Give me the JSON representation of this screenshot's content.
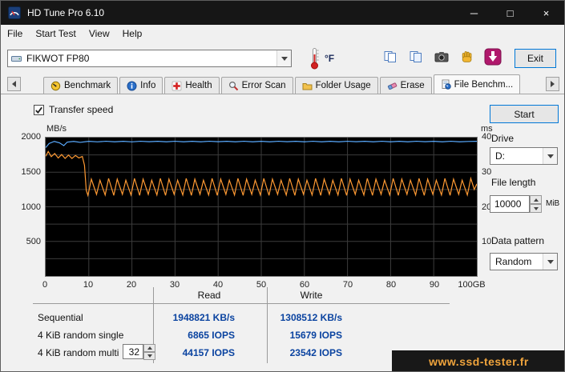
{
  "window": {
    "title": "HD Tune Pro 6.10",
    "controls": {
      "minimize": "─",
      "maximize": "□",
      "close": "×"
    }
  },
  "menu": {
    "items": [
      "File",
      "Start Test",
      "View",
      "Help"
    ]
  },
  "toolbar": {
    "drive_selector": "FIKWOT FP80",
    "temperature_unit": "°F",
    "exit_button": "Exit"
  },
  "tabs": {
    "items": [
      {
        "label": "Benchmark",
        "icon": "speedometer-icon"
      },
      {
        "label": "Info",
        "icon": "info-icon"
      },
      {
        "label": "Health",
        "icon": "health-icon"
      },
      {
        "label": "Error Scan",
        "icon": "error-scan-icon"
      },
      {
        "label": "Folder Usage",
        "icon": "folder-icon"
      },
      {
        "label": "Erase",
        "icon": "eraser-icon"
      },
      {
        "label": "File Benchm...",
        "icon": "file-benchmark-icon",
        "active": true
      }
    ]
  },
  "file_benchmark": {
    "transfer_speed_label": "Transfer speed",
    "transfer_speed_checked": true,
    "start_button": "Start",
    "drive_label": "Drive",
    "drive_value": "D:",
    "file_length_label": "File length",
    "file_length_value": "10000",
    "file_length_unit": "MiB",
    "data_pattern_label": "Data pattern",
    "data_pattern_value": "Random"
  },
  "results": {
    "read_header": "Read",
    "write_header": "Write",
    "rows": [
      {
        "label": "Sequential",
        "read": "1948821 KB/s",
        "write": "1308512 KB/s"
      },
      {
        "label": "4 KiB random single",
        "read": "6865 IOPS",
        "write": "15679 IOPS"
      },
      {
        "label": "4 KiB random multi",
        "threads": "32",
        "read": "44157 IOPS",
        "write": "23542 IOPS"
      }
    ]
  },
  "watermark": {
    "text": "www.ssd-tester.fr"
  },
  "colors": {
    "read_line": "#5aabff",
    "write_line": "#ff9a33",
    "chart_bg": "#000000",
    "chart_grid": "#3c3c3c",
    "value_text": "#0a43a0",
    "watermark_text": "#f0a43c",
    "watermark_bg": "#181818",
    "accent": "#0078d7"
  },
  "chart_data": {
    "type": "line",
    "title": "File Benchmark transfer speed",
    "y_left": {
      "label": "MB/s",
      "min": 0,
      "max": 2000,
      "ticks": [
        500,
        1000,
        1500,
        2000
      ],
      "minor_step": 250
    },
    "y_right": {
      "label": "ms",
      "min": 0,
      "max": 40,
      "ticks": [
        10,
        20,
        30,
        40
      ]
    },
    "x": {
      "min": 0,
      "max": 100,
      "tick_values": [
        0,
        10,
        20,
        30,
        40,
        50,
        60,
        70,
        80,
        90,
        100
      ],
      "tick_labels": [
        "0",
        "10",
        "20",
        "30",
        "40",
        "50",
        "60",
        "70",
        "80",
        "90",
        "100GB"
      ]
    },
    "grid": true,
    "series": [
      {
        "name": "read",
        "color": "#5aabff",
        "points": [
          [
            0,
            1855
          ],
          [
            0.8,
            1915
          ],
          [
            2,
            1945
          ],
          [
            3.2,
            1925
          ],
          [
            4.2,
            1885
          ],
          [
            5,
            1935
          ],
          [
            6.5,
            1945
          ],
          [
            8,
            1932
          ],
          [
            10,
            1946
          ],
          [
            12,
            1938
          ],
          [
            14,
            1947
          ],
          [
            16,
            1940
          ],
          [
            18,
            1946
          ],
          [
            20,
            1938
          ],
          [
            22,
            1947
          ],
          [
            24,
            1941
          ],
          [
            26,
            1946
          ],
          [
            28,
            1939
          ],
          [
            30,
            1947
          ],
          [
            32,
            1940
          ],
          [
            34,
            1946
          ],
          [
            36,
            1939
          ],
          [
            38,
            1947
          ],
          [
            40,
            1941
          ],
          [
            42,
            1946
          ],
          [
            44,
            1939
          ],
          [
            46,
            1947
          ],
          [
            48,
            1940
          ],
          [
            50,
            1946
          ],
          [
            52,
            1939
          ],
          [
            54,
            1947
          ],
          [
            56,
            1941
          ],
          [
            58,
            1946
          ],
          [
            60,
            1939
          ],
          [
            62,
            1947
          ],
          [
            64,
            1940
          ],
          [
            66,
            1946
          ],
          [
            68,
            1939
          ],
          [
            70,
            1947
          ],
          [
            72,
            1941
          ],
          [
            74,
            1946
          ],
          [
            76,
            1939
          ],
          [
            78,
            1947
          ],
          [
            80,
            1940
          ],
          [
            82,
            1946
          ],
          [
            84,
            1939
          ],
          [
            86,
            1947
          ],
          [
            88,
            1941
          ],
          [
            90,
            1946
          ],
          [
            92,
            1939
          ],
          [
            94,
            1947
          ],
          [
            96,
            1940
          ],
          [
            98,
            1944
          ],
          [
            100,
            1946
          ]
        ]
      },
      {
        "name": "write",
        "color": "#ff9a33",
        "points": [
          [
            0,
            1730
          ],
          [
            0.6,
            1800
          ],
          [
            1.3,
            1725
          ],
          [
            2.1,
            1770
          ],
          [
            2.9,
            1705
          ],
          [
            3.7,
            1755
          ],
          [
            4.5,
            1700
          ],
          [
            5.3,
            1748
          ],
          [
            6.1,
            1698
          ],
          [
            6.9,
            1742
          ],
          [
            7.7,
            1706
          ],
          [
            8.5,
            1728
          ],
          [
            9,
            1600
          ],
          [
            9.4,
            1240
          ],
          [
            9.8,
            1165
          ],
          [
            10.6,
            1400
          ],
          [
            11.8,
            1180
          ],
          [
            12.6,
            1385
          ],
          [
            13.8,
            1170
          ],
          [
            14.6,
            1410
          ],
          [
            15.8,
            1165
          ],
          [
            16.6,
            1400
          ],
          [
            17.8,
            1180
          ],
          [
            18.6,
            1385
          ],
          [
            19.8,
            1170
          ],
          [
            20.6,
            1410
          ],
          [
            21.8,
            1165
          ],
          [
            22.6,
            1400
          ],
          [
            23.8,
            1180
          ],
          [
            24.6,
            1385
          ],
          [
            25.8,
            1170
          ],
          [
            26.6,
            1410
          ],
          [
            27.8,
            1165
          ],
          [
            28.6,
            1400
          ],
          [
            29.8,
            1180
          ],
          [
            30.6,
            1385
          ],
          [
            31.8,
            1170
          ],
          [
            32.6,
            1410
          ],
          [
            33.8,
            1165
          ],
          [
            34.6,
            1400
          ],
          [
            35.8,
            1180
          ],
          [
            36.6,
            1385
          ],
          [
            37.8,
            1170
          ],
          [
            38.6,
            1410
          ],
          [
            39.8,
            1165
          ],
          [
            40.6,
            1400
          ],
          [
            41.8,
            1180
          ],
          [
            42.6,
            1385
          ],
          [
            43.8,
            1170
          ],
          [
            44.6,
            1410
          ],
          [
            45.8,
            1165
          ],
          [
            46.6,
            1400
          ],
          [
            47.8,
            1180
          ],
          [
            48.6,
            1385
          ],
          [
            49.8,
            1170
          ],
          [
            50.6,
            1410
          ],
          [
            51.8,
            1165
          ],
          [
            52.6,
            1400
          ],
          [
            53.8,
            1180
          ],
          [
            54.6,
            1385
          ],
          [
            55.8,
            1170
          ],
          [
            56.6,
            1410
          ],
          [
            57.8,
            1165
          ],
          [
            58.6,
            1400
          ],
          [
            59.8,
            1180
          ],
          [
            60.6,
            1385
          ],
          [
            61.8,
            1170
          ],
          [
            62.6,
            1410
          ],
          [
            63.8,
            1165
          ],
          [
            64.6,
            1400
          ],
          [
            65.8,
            1180
          ],
          [
            66.6,
            1385
          ],
          [
            67.8,
            1170
          ],
          [
            68.6,
            1410
          ],
          [
            69.8,
            1165
          ],
          [
            70.6,
            1400
          ],
          [
            71.8,
            1180
          ],
          [
            72.6,
            1385
          ],
          [
            73.8,
            1170
          ],
          [
            74.6,
            1410
          ],
          [
            75.8,
            1165
          ],
          [
            76.6,
            1400
          ],
          [
            77.8,
            1180
          ],
          [
            78.6,
            1385
          ],
          [
            79.8,
            1170
          ],
          [
            80.6,
            1410
          ],
          [
            81.8,
            1165
          ],
          [
            82.6,
            1400
          ],
          [
            83.8,
            1180
          ],
          [
            84.6,
            1385
          ],
          [
            85.8,
            1170
          ],
          [
            86.6,
            1410
          ],
          [
            87.8,
            1165
          ],
          [
            88.6,
            1400
          ],
          [
            89.8,
            1180
          ],
          [
            90.6,
            1385
          ],
          [
            91.8,
            1170
          ],
          [
            92.6,
            1410
          ],
          [
            93.8,
            1165
          ],
          [
            94.6,
            1400
          ],
          [
            95.8,
            1180
          ],
          [
            96.6,
            1385
          ],
          [
            97.8,
            1170
          ],
          [
            98.6,
            1410
          ],
          [
            99.4,
            1250
          ],
          [
            100,
            1330
          ]
        ]
      }
    ]
  }
}
